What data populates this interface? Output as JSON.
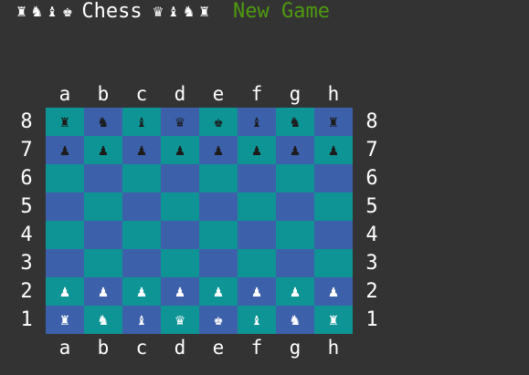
{
  "header": {
    "left_icons": [
      "♜",
      "♞",
      "♝",
      "♚"
    ],
    "title": "Chess",
    "right_icons": [
      "♛",
      "♝",
      "♞",
      "♜"
    ],
    "new_game_label": "New Game"
  },
  "board": {
    "files": [
      "a",
      "b",
      "c",
      "d",
      "e",
      "f",
      "g",
      "h"
    ],
    "ranks": [
      "8",
      "7",
      "6",
      "5",
      "4",
      "3",
      "2",
      "1"
    ],
    "squares": [
      [
        "♜",
        "♞",
        "♝",
        "♛",
        "♚",
        "♝",
        "♞",
        "♜"
      ],
      [
        "♟",
        "♟",
        "♟",
        "♟",
        "♟",
        "♟",
        "♟",
        "♟"
      ],
      [
        "",
        "",
        "",
        "",
        "",
        "",
        "",
        ""
      ],
      [
        "",
        "",
        "",
        "",
        "",
        "",
        "",
        ""
      ],
      [
        "",
        "",
        "",
        "",
        "",
        "",
        "",
        ""
      ],
      [
        "",
        "",
        "",
        "",
        "",
        "",
        "",
        ""
      ],
      [
        "♟",
        "♟",
        "♟",
        "♟",
        "♟",
        "♟",
        "♟",
        "♟"
      ],
      [
        "♜",
        "♞",
        "♝",
        "♛",
        "♚",
        "♝",
        "♞",
        "♜"
      ]
    ],
    "piece_colors": [
      [
        "black",
        "black",
        "black",
        "black",
        "black",
        "black",
        "black",
        "black"
      ],
      [
        "black",
        "black",
        "black",
        "black",
        "black",
        "black",
        "black",
        "black"
      ],
      [
        "",
        "",
        "",
        "",
        "",
        "",
        "",
        ""
      ],
      [
        "",
        "",
        "",
        "",
        "",
        "",
        "",
        ""
      ],
      [
        "",
        "",
        "",
        "",
        "",
        "",
        "",
        ""
      ],
      [
        "",
        "",
        "",
        "",
        "",
        "",
        "",
        ""
      ],
      [
        "white",
        "white",
        "white",
        "white",
        "white",
        "white",
        "white",
        "white"
      ],
      [
        "white",
        "white",
        "white",
        "white",
        "white",
        "white",
        "white",
        "white"
      ]
    ],
    "colors": {
      "light": "#0e9494",
      "dark": "#3d60aa",
      "background": "#333333",
      "accent": "#4f9a0f"
    }
  }
}
